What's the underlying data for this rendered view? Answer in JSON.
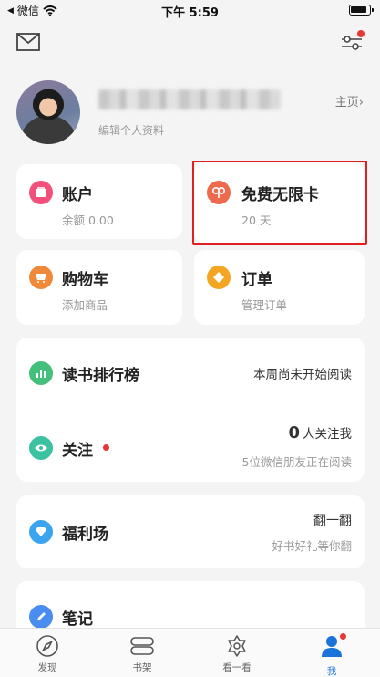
{
  "status_bar": {
    "carrier": "微信",
    "time": "下午 5:59"
  },
  "profile": {
    "edit_label": "编辑个人资料",
    "homepage_label": "主页"
  },
  "tiles": {
    "account": {
      "title": "账户",
      "sub": "余额 0.00",
      "color": "#f0507a"
    },
    "free_card": {
      "title": "免费无限卡",
      "sub": "20 天",
      "color": "#ee6a4f"
    },
    "cart": {
      "title": "购物车",
      "sub": "添加商品",
      "color": "#f08a3a"
    },
    "orders": {
      "title": "订单",
      "sub": "管理订单",
      "color": "#f4a521"
    }
  },
  "rows": {
    "ranking": {
      "title": "读书排行榜",
      "right": "本周尚未开始阅读",
      "color": "#43c07c"
    },
    "follow": {
      "title": "关注",
      "count": "0",
      "count_suffix": "人关注我",
      "sub": "5位微信朋友正在阅读",
      "color": "#3cc2a0"
    },
    "welfare": {
      "title": "福利场",
      "right": "翻一翻",
      "sub": "好书好礼等你翻",
      "color": "#3aa5ee"
    },
    "notes": {
      "title": "笔记",
      "color": "#4a8df0"
    }
  },
  "tabbar": {
    "items": [
      {
        "label": "发现",
        "icon": "compass-icon"
      },
      {
        "label": "书架",
        "icon": "bookshelf-icon"
      },
      {
        "label": "看一看",
        "icon": "look-icon"
      },
      {
        "label": "我",
        "icon": "person-icon",
        "active": true
      }
    ],
    "active_color": "#1a73d9"
  }
}
